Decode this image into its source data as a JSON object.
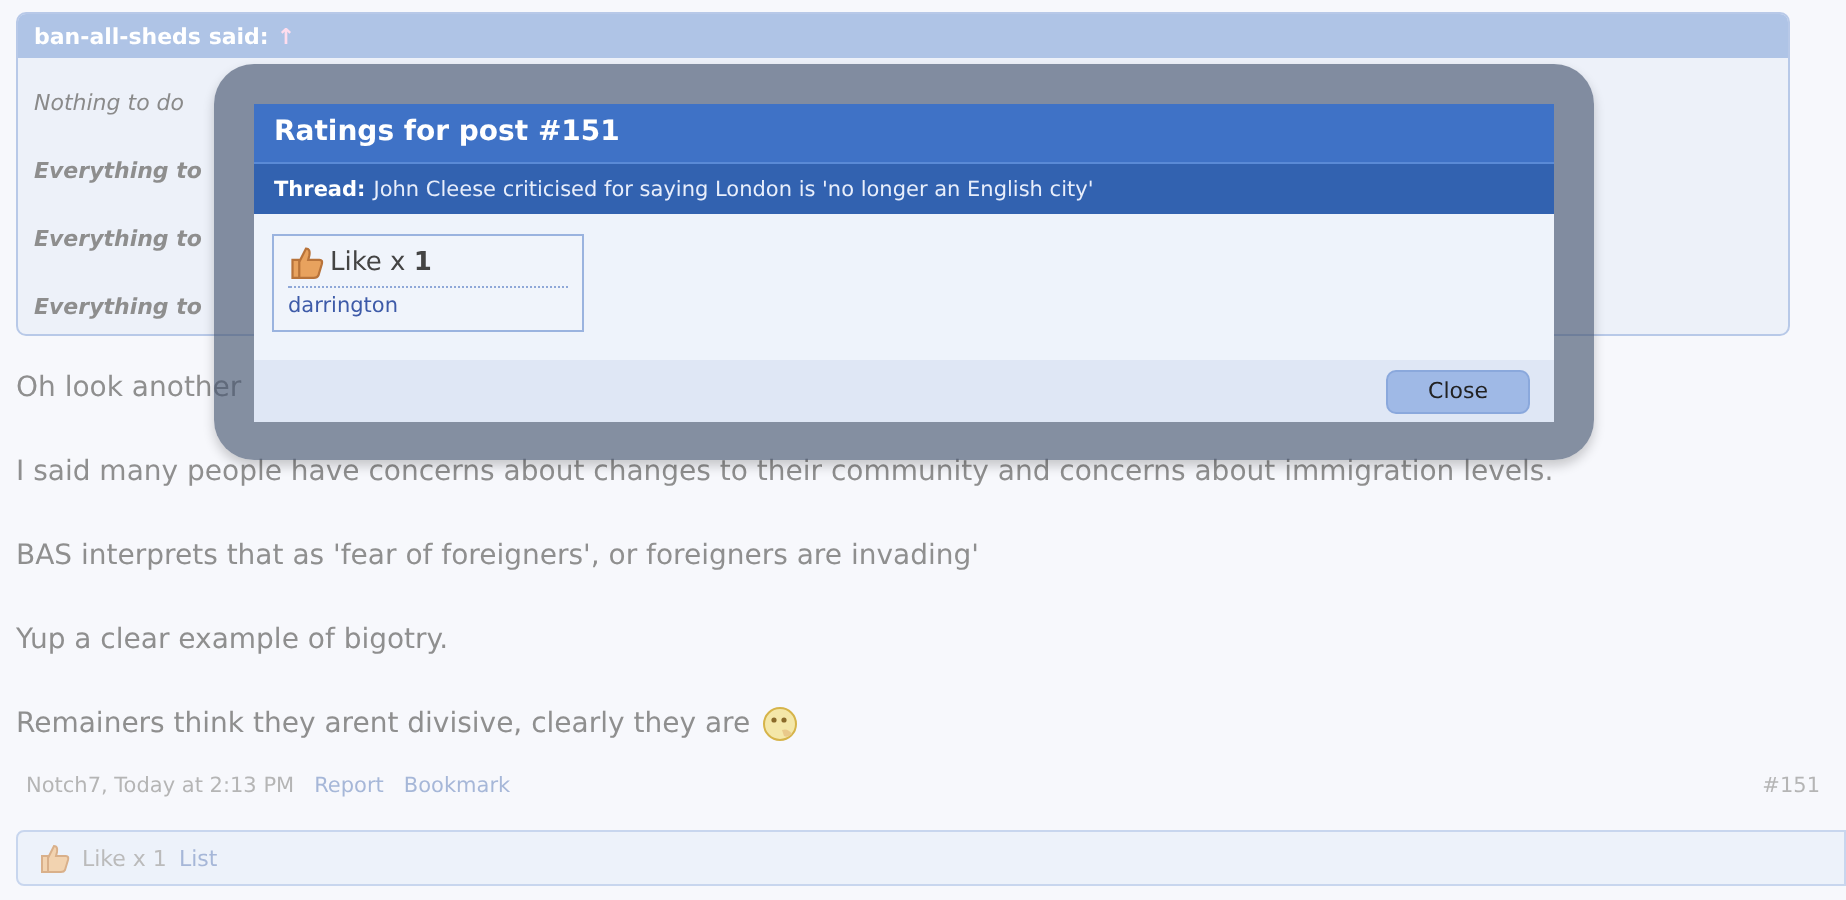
{
  "quote": {
    "author": "ban-all-sheds said:",
    "arrow": "↑",
    "lines": [
      {
        "text": "Nothing to do",
        "bold": false
      },
      {
        "text": "Everything to",
        "bold": true
      },
      {
        "text": "Everything to",
        "bold": true
      },
      {
        "text": "Everything to",
        "bold": true
      }
    ]
  },
  "post_lines": [
    "Oh look another",
    "I said many people have concerns about changes to their community and concerns about immigration levels.",
    "BAS interprets that as 'fear of foreigners', or foreigners are invading'",
    "Yup a clear example of bigotry.",
    "Remainers think they arent divisive, clearly they are"
  ],
  "meta": {
    "author_time": "Notch7, Today at 2:13 PM",
    "links": [
      "Report",
      "Bookmark"
    ],
    "post_number": "#151"
  },
  "ratings_bar": {
    "summary": "Like x 1",
    "link": "List"
  },
  "modal": {
    "title": "Ratings for post #151",
    "thread_label": "Thread:",
    "thread_title": "John Cleese criticised for saying London is 'no longer an English city'",
    "rating": {
      "label": "Like x ",
      "count": "1",
      "users": [
        "darrington"
      ]
    },
    "close": "Close"
  }
}
